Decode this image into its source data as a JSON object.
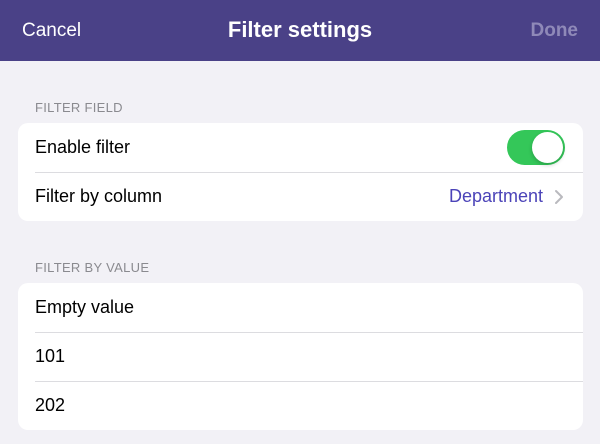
{
  "navbar": {
    "cancel_label": "Cancel",
    "title": "Filter settings",
    "done_label": "Done"
  },
  "filter_field": {
    "header": "FILTER FIELD",
    "enable_filter": {
      "label": "Enable filter",
      "enabled": true
    },
    "filter_by_column": {
      "label": "Filter by column",
      "value": "Department"
    }
  },
  "filter_by_value": {
    "header": "FILTER BY VALUE",
    "items": [
      {
        "label": "Empty value"
      },
      {
        "label": "101"
      },
      {
        "label": "202"
      }
    ]
  },
  "colors": {
    "navbar_bg": "#4a4187",
    "accent": "#4b43b8",
    "toggle_on": "#34c759",
    "done_disabled": "#8f89b8"
  },
  "icons": {
    "chevron": "chevron-right-icon"
  }
}
